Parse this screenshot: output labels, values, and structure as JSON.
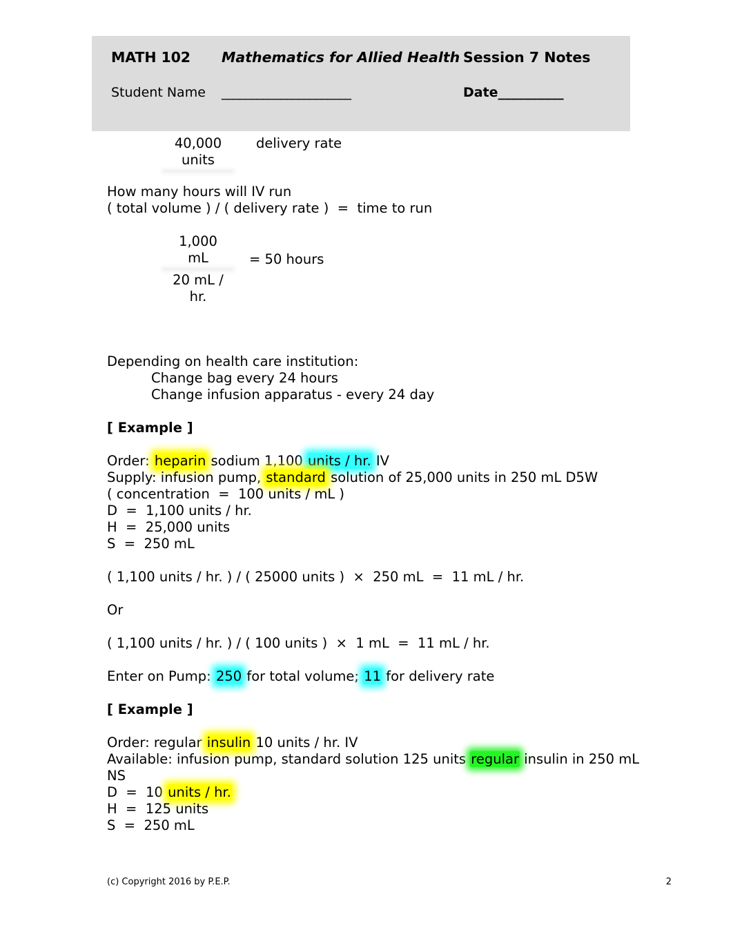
{
  "header": {
    "course_code": "MATH 102",
    "course_title": "Mathematics for Allied Health",
    "session_label": "Session 7 Notes",
    "student_name_label": "Student Name",
    "student_name_blank": "______________________",
    "date_label": "Date",
    "date_blank": "__________"
  },
  "content": {
    "frac1": {
      "numerator": "40,000",
      "numerator_unit": "units",
      "denominator": "",
      "side_label": "delivery rate"
    },
    "question_line": "How many hours will IV run",
    "formula_line": "( total volume ) / ( delivery rate )  =  time to run",
    "frac2": {
      "numerator": "1,000",
      "numerator_unit": "mL",
      "denominator": "20 mL /",
      "denominator_unit": "hr.",
      "result": "=  50 hours"
    },
    "depending_heading": "Depending on health care institution:",
    "depending_items": [
      "Change bag every 24 hours",
      "Change infusion apparatus - every 24 day"
    ]
  },
  "example1": {
    "heading": "[ Example ]",
    "order_prefix": "Order: ",
    "order_hl_heparin": "heparin",
    "order_mid": " sodium 1,100 ",
    "order_hl_unitshr": "units / hr.",
    "order_suffix": " IV",
    "supply_prefix": "Supply: infusion pump, ",
    "supply_hl_standard": "standard",
    "supply_suffix": " solution of 25,000 units in 250 mL D5W",
    "concentration": "( concentration  =  100 units / mL )",
    "d_line": "D  =  1,100 units / hr.",
    "h_line": "H  =  25,000 units",
    "s_line": "S  =  250 mL",
    "calc1": "( 1,100 units / hr. ) / ( 25000 units )  ×  250 mL  =  11 mL / hr.",
    "or_label": "Or",
    "calc2": "( 1,100 units / hr. ) / ( 100 units )  ×  1 mL  =  11 mL / hr.",
    "pump_prefix": "Enter on Pump: ",
    "pump_hl_volume": "250",
    "pump_mid": " for total volume; ",
    "pump_hl_rate": "11",
    "pump_suffix": " for delivery rate"
  },
  "example2": {
    "heading": "[ Example ]",
    "order_prefix": "Order: regular ",
    "order_hl_insulin": "insulin",
    "order_suffix": " 10 units / hr. IV",
    "available_prefix": "Available: infusion pump, standard solution 125 units ",
    "available_hl_regular": "regular",
    "available_suffix": " insulin in 250 mL NS",
    "d_prefix": "D  =  10 ",
    "d_hl_unitshr": "units / hr.",
    "h_line": "H  =  125 units",
    "s_line": "S  =  250 mL"
  },
  "footer": {
    "copyright": "(c) Copyright 2016 by P.E.P.",
    "page_number": "2"
  },
  "colors": {
    "header_background": "#dcdcdc",
    "highlight_yellow": "#ffff00",
    "highlight_cyan": "#33ffff",
    "highlight_green": "#24f524",
    "text": "#000000",
    "page_background": "#ffffff"
  }
}
